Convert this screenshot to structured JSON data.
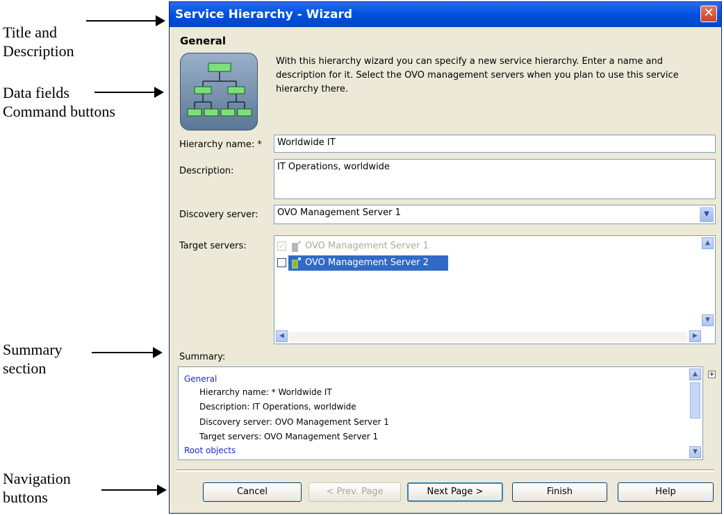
{
  "annotations": {
    "title_desc_line1": "Title and",
    "title_desc_line2": "Description",
    "data_fields": "Data fields",
    "command_buttons": "Command buttons",
    "summary_line1": "Summary",
    "summary_line2": "section",
    "navigation_line1": "Navigation",
    "navigation_line2": "buttons"
  },
  "dialog": {
    "title": "Service Hierarchy - Wizard",
    "close_glyph": "✕",
    "section_title": "General",
    "intro_text": "With this hierarchy wizard you can specify a new service hierarchy. Enter a name and description for it. Select the OVO management servers when you plan to use this service hierarchy there."
  },
  "fields": {
    "hierarchy_name_label": "Hierarchy name: *",
    "hierarchy_name_value": "Worldwide IT",
    "description_label": "Description:",
    "description_value": "IT Operations, worldwide",
    "discovery_server_label": "Discovery server:",
    "discovery_server_value": "OVO Management Server 1",
    "target_servers_label": "Target servers:",
    "target_servers": [
      {
        "label": "OVO Management Server 1",
        "checked": true,
        "disabled": true
      },
      {
        "label": "OVO Management Server 2",
        "checked": false,
        "selected": true
      }
    ]
  },
  "summary": {
    "label": "Summary:",
    "general_link": "General",
    "lines": [
      "Hierarchy name: * Worldwide IT",
      "Description: IT Operations, worldwide",
      "Discovery server: OVO Management Server 1",
      "Target servers:  OVO Management Server 1"
    ],
    "root_objects_link": "Root objects"
  },
  "buttons": {
    "cancel": "Cancel",
    "prev": "< Prev. Page",
    "next": "Next Page >",
    "finish": "Finish",
    "help": "Help"
  },
  "colors": {
    "titlebar": "#0052e0",
    "dialog_bg": "#ece9d8",
    "selection": "#316ac5",
    "link": "#1a28cc"
  }
}
